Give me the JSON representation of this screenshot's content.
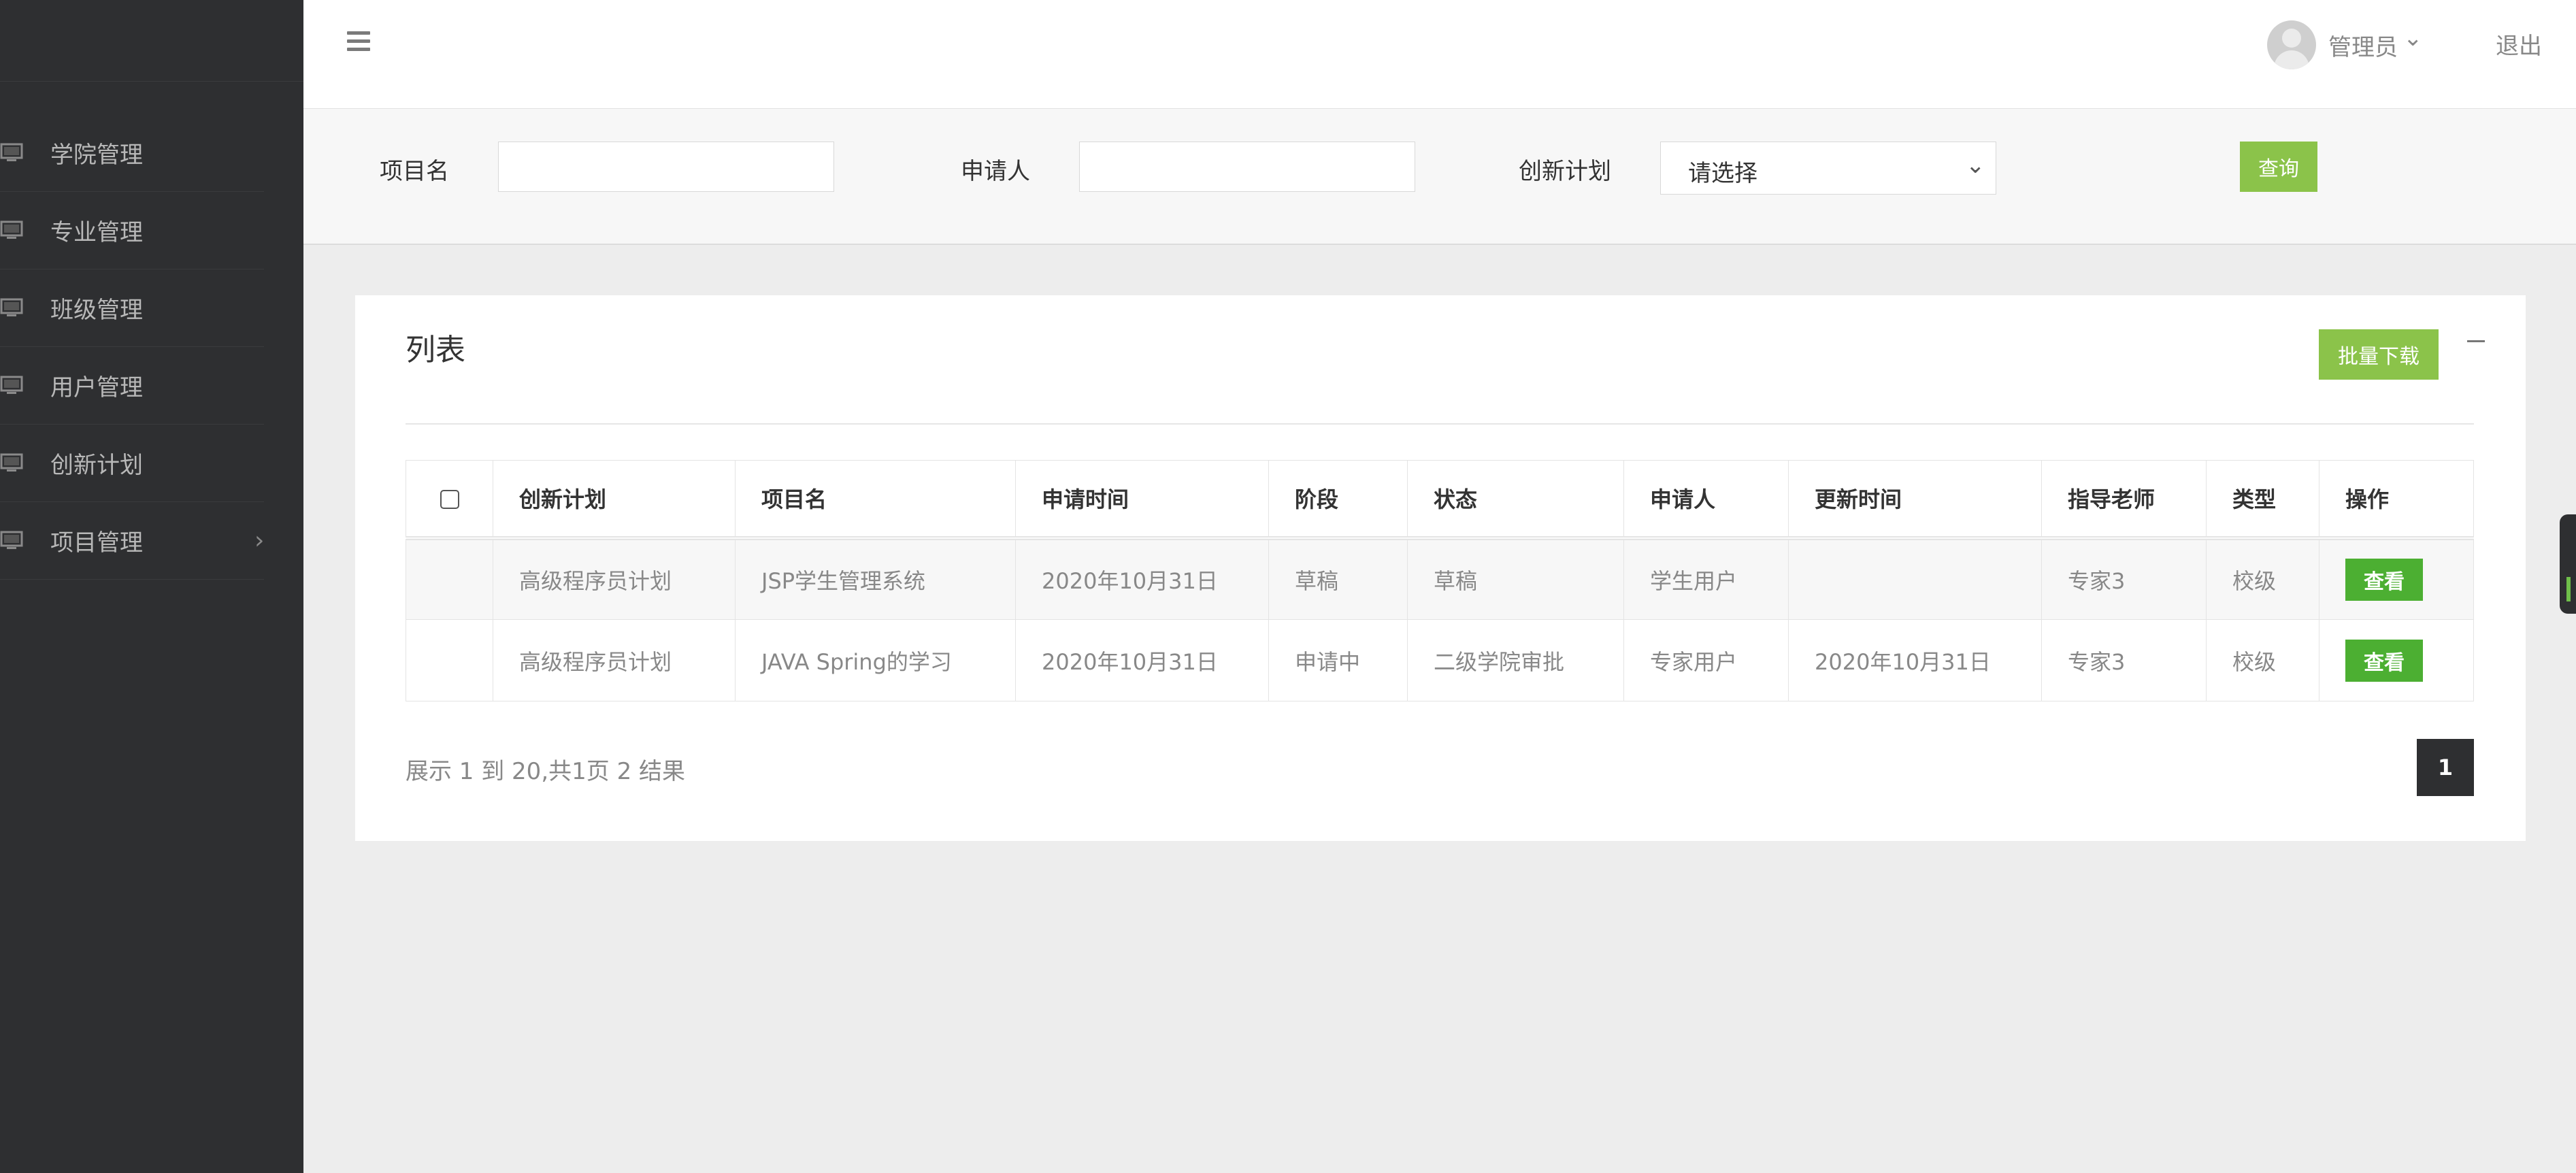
{
  "sidebar": {
    "items": [
      {
        "label": "学院管理",
        "icon": "monitor-icon"
      },
      {
        "label": "专业管理",
        "icon": "monitor-icon"
      },
      {
        "label": "班级管理",
        "icon": "monitor-icon"
      },
      {
        "label": "用户管理",
        "icon": "monitor-icon"
      },
      {
        "label": "创新计划",
        "icon": "monitor-icon"
      },
      {
        "label": "项目管理",
        "icon": "monitor-icon",
        "arrow": "›"
      }
    ]
  },
  "header": {
    "menu_icon": "hamburger-icon",
    "user_name": "管理员",
    "user_chevron": "⌄",
    "logout": "退出"
  },
  "search": {
    "project_label": "项目名",
    "project_value": "",
    "applicant_label": "申请人",
    "applicant_value": "",
    "plan_label": "创新计划",
    "plan_selected": "请选择",
    "plan_chevron": "⌄",
    "query_button": "查询"
  },
  "panel": {
    "title": "列表",
    "batch_download": "批量下载"
  },
  "table": {
    "columns": [
      "创新计划",
      "项目名",
      "申请时间",
      "阶段",
      "状态",
      "申请人",
      "更新时间",
      "指导老师",
      "类型",
      "操作"
    ],
    "rows": [
      {
        "plan": "高级程序员计划",
        "project": "JSP学生管理系统",
        "apply_time": "2020年10月31日",
        "stage": "草稿",
        "status": "草稿",
        "applicant": "学生用户",
        "update_time": "",
        "teacher": "专家3",
        "type": "校级",
        "action": "查看"
      },
      {
        "plan": "高级程序员计划",
        "project": "JAVA Spring的学习",
        "apply_time": "2020年10月31日",
        "stage": "申请中",
        "status": "二级学院审批",
        "applicant": "专家用户",
        "update_time": "2020年10月31日",
        "teacher": "专家3",
        "type": "校级",
        "action": "查看"
      }
    ]
  },
  "pagination": {
    "summary": "展示 1 到 20,共1页 2 结果",
    "current_page": "1"
  },
  "colors": {
    "sidebar_bg": "#2e2f31",
    "accent_green": "#8bc34a",
    "view_button": "#4caf32"
  }
}
